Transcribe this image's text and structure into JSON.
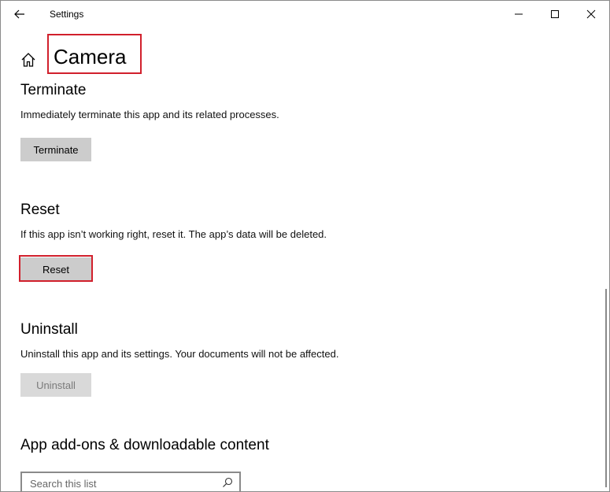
{
  "window": {
    "title": "Settings",
    "back_icon": "back-arrow-icon",
    "controls": [
      "minimize-icon",
      "maximize-icon",
      "close-icon"
    ]
  },
  "header": {
    "home_icon": "home-icon",
    "title": "Camera"
  },
  "terminate": {
    "heading": "Terminate",
    "description": "Immediately terminate this app and its related processes.",
    "button_label": "Terminate"
  },
  "reset": {
    "heading": "Reset",
    "description": "If this app isn’t working right, reset it. The app’s data will be deleted.",
    "button_label": "Reset"
  },
  "uninstall": {
    "heading": "Uninstall",
    "description": "Uninstall this app and its settings. Your documents will not be affected.",
    "button_label": "Uninstall",
    "button_disabled": true
  },
  "addons": {
    "heading": "App add-ons & downloadable content",
    "search_placeholder": "Search this list",
    "search_icon": "search-icon"
  },
  "colors": {
    "highlight": "#d1202c",
    "button_bg": "#cccccc",
    "disabled_text": "#7a7a7a"
  }
}
